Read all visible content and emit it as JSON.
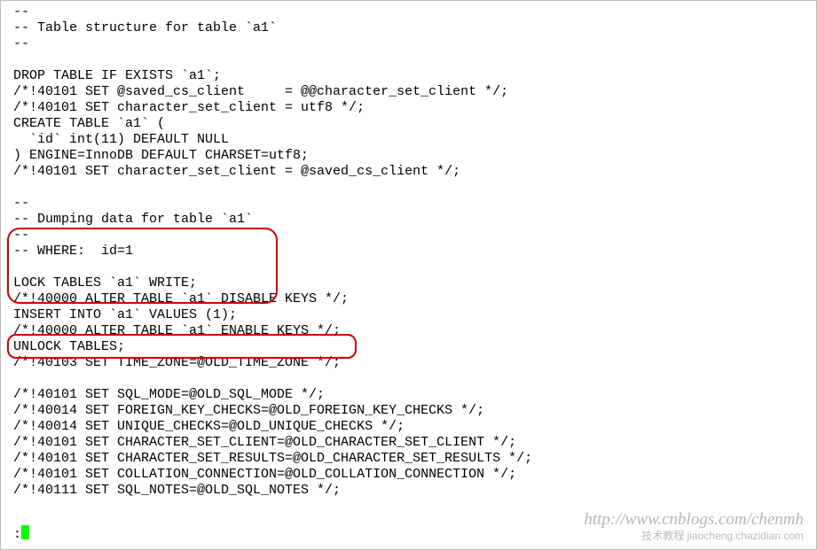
{
  "code": {
    "lines": [
      "--",
      "-- Table structure for table `a1`",
      "--",
      "",
      "DROP TABLE IF EXISTS `a1`;",
      "/*!40101 SET @saved_cs_client     = @@character_set_client */;",
      "/*!40101 SET character_set_client = utf8 */;",
      "CREATE TABLE `a1` (",
      "  `id` int(11) DEFAULT NULL",
      ") ENGINE=InnoDB DEFAULT CHARSET=utf8;",
      "/*!40101 SET character_set_client = @saved_cs_client */;",
      "",
      "--",
      "-- Dumping data for table `a1`",
      "--",
      "-- WHERE:  id=1",
      "",
      "LOCK TABLES `a1` WRITE;",
      "/*!40000 ALTER TABLE `a1` DISABLE KEYS */;",
      "INSERT INTO `a1` VALUES (1);",
      "/*!40000 ALTER TABLE `a1` ENABLE KEYS */;",
      "UNLOCK TABLES;",
      "/*!40103 SET TIME_ZONE=@OLD_TIME_ZONE */;",
      "",
      "/*!40101 SET SQL_MODE=@OLD_SQL_MODE */;",
      "/*!40014 SET FOREIGN_KEY_CHECKS=@OLD_FOREIGN_KEY_CHECKS */;",
      "/*!40014 SET UNIQUE_CHECKS=@OLD_UNIQUE_CHECKS */;",
      "/*!40101 SET CHARACTER_SET_CLIENT=@OLD_CHARACTER_SET_CLIENT */;",
      "/*!40101 SET CHARACTER_SET_RESULTS=@OLD_CHARACTER_SET_RESULTS */;",
      "/*!40101 SET COLLATION_CONNECTION=@OLD_COLLATION_CONNECTION */;",
      "/*!40111 SET SQL_NOTES=@OLD_SQL_NOTES */;"
    ]
  },
  "prompt": {
    "prefix": ":"
  },
  "watermark": {
    "url": "http://www.cnblogs.com/chenmh",
    "site": "技术教程 jiaocheng.chazidian.com"
  }
}
